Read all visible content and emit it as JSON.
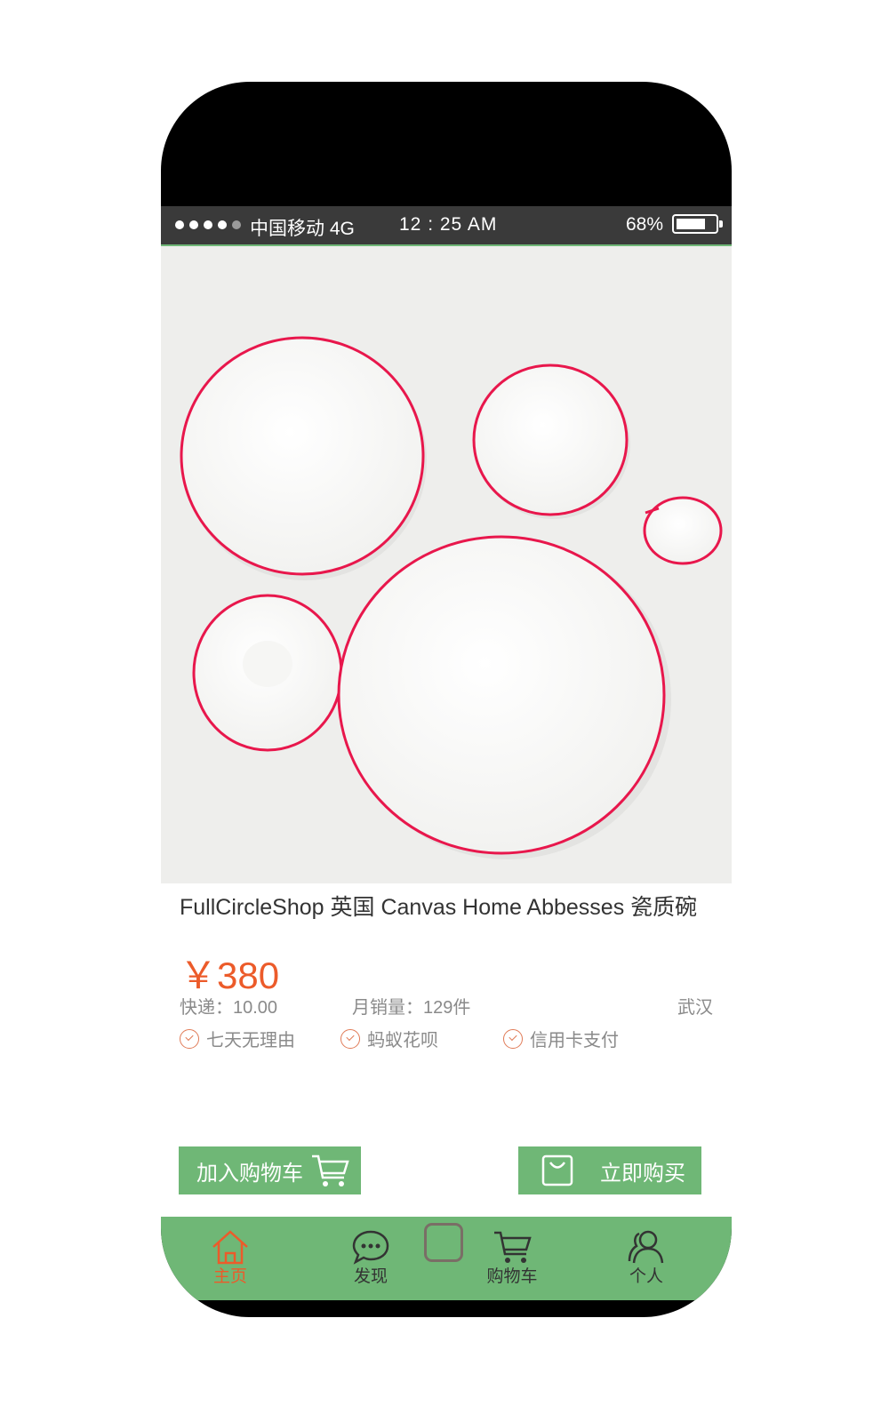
{
  "status_bar": {
    "carrier": "中国移动 4G",
    "time": "12 : 25  AM",
    "battery_percent": "68%",
    "battery_level": 0.68
  },
  "product": {
    "title": "FullCircleShop 英国 Canvas Home Abbesses 瓷质碗",
    "price": "￥380",
    "shipping": "快递：10.00",
    "monthly_sales": "月销量：129件",
    "location": "武汉",
    "badges": [
      "七天无理由",
      "蚂蚁花呗",
      "信用卡支付"
    ]
  },
  "actions": {
    "add_to_cart": "加入购物车",
    "buy_now": "立即购买"
  },
  "tabs": [
    {
      "label": "主页",
      "icon": "home-icon",
      "active": true
    },
    {
      "label": "发现",
      "icon": "chat-bubble-icon",
      "active": false
    },
    {
      "label": "购物车",
      "icon": "cart-icon",
      "active": false
    },
    {
      "label": "个人",
      "icon": "user-icon",
      "active": false
    }
  ],
  "colors": {
    "accent_green": "#6fb776",
    "price_orange": "#ec5b2a",
    "plate_rim_red": "#e8174c"
  }
}
